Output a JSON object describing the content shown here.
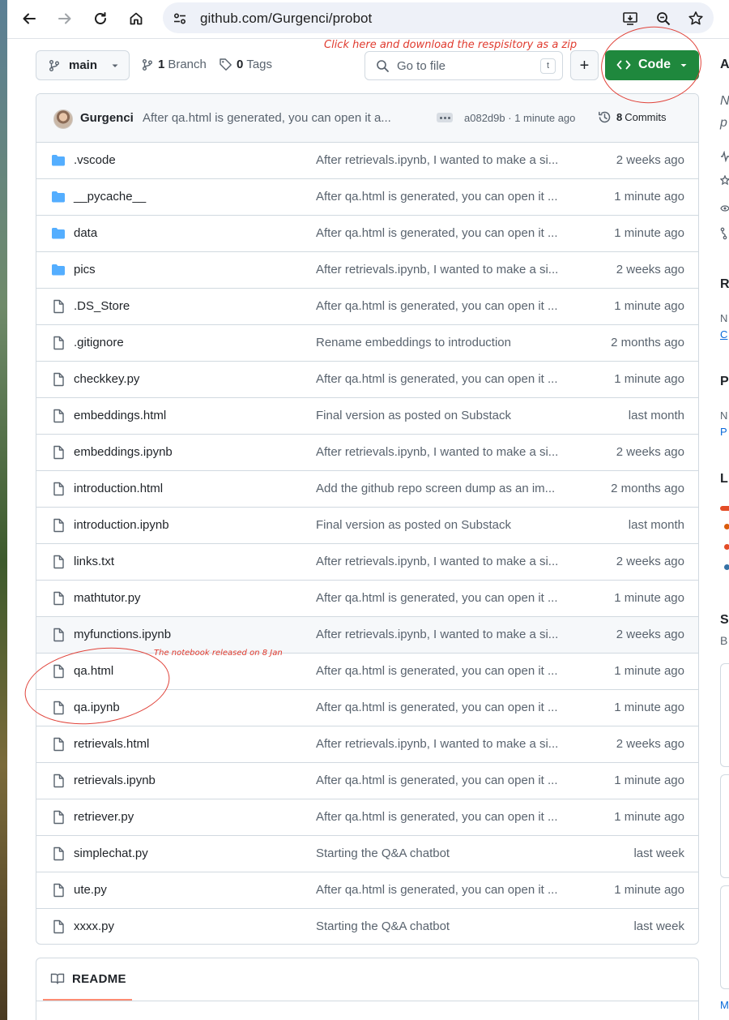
{
  "browser": {
    "url": "github.com/Gurgenci/probot"
  },
  "toolbar": {
    "branch": "main",
    "branch_count": "1",
    "branch_label": "Branch",
    "tag_count": "0",
    "tag_label": "Tags",
    "search_placeholder": "Go to file",
    "search_shortcut": "t",
    "add_label": "+",
    "code_label": "Code"
  },
  "annotations": {
    "code_note": "Click here and download the respisitory as a zip",
    "notebook_note": "The notebook released on 8 Jan"
  },
  "commit": {
    "author": "Gurgenci",
    "message": "After qa.html is generated, you can open it a...",
    "hash": "a082d9b",
    "separator": "·",
    "time": "1 minute ago",
    "commit_count": "8",
    "commit_label": "Commits"
  },
  "files": [
    {
      "name": ".vscode",
      "type": "folder",
      "message": "After retrievals.ipynb, I wanted to make a si...",
      "date": "2 weeks ago"
    },
    {
      "name": "__pycache__",
      "type": "folder",
      "message": "After qa.html is generated, you can open it ...",
      "date": "1 minute ago"
    },
    {
      "name": "data",
      "type": "folder",
      "message": "After qa.html is generated, you can open it ...",
      "date": "1 minute ago"
    },
    {
      "name": "pics",
      "type": "folder",
      "message": "After retrievals.ipynb, I wanted to make a si...",
      "date": "2 weeks ago"
    },
    {
      "name": ".DS_Store",
      "type": "file",
      "message": "After qa.html is generated, you can open it ...",
      "date": "1 minute ago"
    },
    {
      "name": ".gitignore",
      "type": "file",
      "message": "Rename embeddings to introduction",
      "date": "2 months ago"
    },
    {
      "name": "checkkey.py",
      "type": "file",
      "message": "After qa.html is generated, you can open it ...",
      "date": "1 minute ago"
    },
    {
      "name": "embeddings.html",
      "type": "file",
      "message": "Final version as posted on Substack",
      "date": "last month"
    },
    {
      "name": "embeddings.ipynb",
      "type": "file",
      "message": "After retrievals.ipynb, I wanted to make a si...",
      "date": "2 weeks ago"
    },
    {
      "name": "introduction.html",
      "type": "file",
      "message": "Add the github repo screen dump as an im...",
      "date": "2 months ago"
    },
    {
      "name": "introduction.ipynb",
      "type": "file",
      "message": "Final version as posted on Substack",
      "date": "last month"
    },
    {
      "name": "links.txt",
      "type": "file",
      "message": "After retrievals.ipynb, I wanted to make a si...",
      "date": "2 weeks ago"
    },
    {
      "name": "mathtutor.py",
      "type": "file",
      "message": "After qa.html is generated, you can open it ...",
      "date": "1 minute ago"
    },
    {
      "name": "myfunctions.ipynb",
      "type": "file",
      "message": "After retrievals.ipynb, I wanted to make a si...",
      "date": "2 weeks ago"
    },
    {
      "name": "qa.html",
      "type": "file",
      "message": "After qa.html is generated, you can open it ...",
      "date": "1 minute ago"
    },
    {
      "name": "qa.ipynb",
      "type": "file",
      "message": "After qa.html is generated, you can open it ...",
      "date": "1 minute ago"
    },
    {
      "name": "retrievals.html",
      "type": "file",
      "message": "After retrievals.ipynb, I wanted to make a si...",
      "date": "2 weeks ago"
    },
    {
      "name": "retrievals.ipynb",
      "type": "file",
      "message": "After qa.html is generated, you can open it ...",
      "date": "1 minute ago"
    },
    {
      "name": "retriever.py",
      "type": "file",
      "message": "After qa.html is generated, you can open it ...",
      "date": "1 minute ago"
    },
    {
      "name": "simplechat.py",
      "type": "file",
      "message": "Starting the Q&A chatbot",
      "date": "last week"
    },
    {
      "name": "ute.py",
      "type": "file",
      "message": "After qa.html is generated, you can open it ...",
      "date": "1 minute ago"
    },
    {
      "name": "xxxx.py",
      "type": "file",
      "message": "Starting the Q&A chatbot",
      "date": "last week"
    }
  ],
  "highlighted_row": "myfunctions.ipynb",
  "readme": {
    "tab_label": "README"
  },
  "sidebar_fragments": {
    "about_initial": "A",
    "desc_line1": "N",
    "desc_line2": "p",
    "section_r": "R",
    "r_line": "N",
    "r_link": "C",
    "section_p": "P",
    "p_line": "N",
    "p_link": "P",
    "section_l": "L",
    "section_s": "S",
    "s_line": "B",
    "bottom_link": "M"
  },
  "colors": {
    "accent_green": "#1f883d",
    "folder_blue": "#54aeff",
    "annotation_red": "#e03b2f",
    "link_blue": "#0969da"
  }
}
